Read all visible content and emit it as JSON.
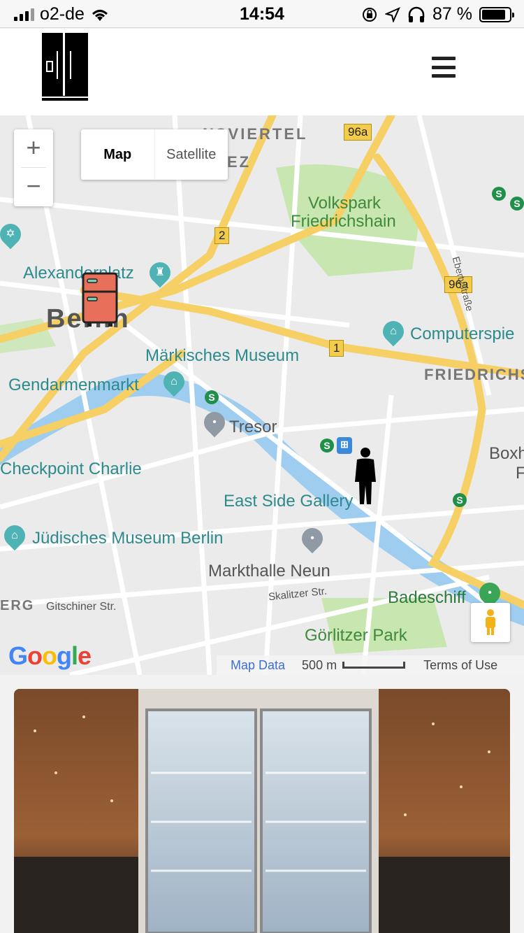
{
  "status_bar": {
    "carrier": "o2-de",
    "time": "14:54",
    "battery_percent": "87 %",
    "battery_level": 0.87
  },
  "header": {
    "logo_icon": "fridge-logo-icon",
    "menu_icon": "hamburger-menu-icon"
  },
  "map": {
    "map_type_options": [
      "Map",
      "Satellite"
    ],
    "selected_map_type": "Map",
    "zoom_in": "+",
    "zoom_out": "−",
    "labels": {
      "volkspark": [
        "Volkspark",
        "Friedrichshain"
      ],
      "alexanderplatz": "Alexanderplatz",
      "berlin": "Berlin",
      "maerkisches_museum": "Märkisches Museum",
      "gendarmenmarkt": "Gendarmenmarkt",
      "tresor": "Tresor",
      "checkpoint_charlie": "Checkpoint Charlie",
      "east_side_gallery": "East Side Gallery",
      "juedisches_museum": "Jüdisches Museum Berlin",
      "markthalle_neun": "Markthalle Neun",
      "badeschiff": "Badeschiff",
      "goerlitzer_park": "Görlitzer Park",
      "computerspiele": "Computerspie",
      "friedrichshain_district": "FRIEDRICHS",
      "viertel": "NSVIERTEL",
      "ez": "EZ",
      "boxh": "Boxh",
      "boxh_f": "F",
      "gitschiner": "Gitschiner Str.",
      "skalitzer": "Skalitzer Str.",
      "erg": "ERG",
      "ebertystrasse": "Ebertystraße"
    },
    "road_shields": [
      "96a",
      "2",
      "96a",
      "1"
    ],
    "google_logo": "Google",
    "map_data": "Map Data",
    "scale": "500 m",
    "terms": "Terms of Use",
    "markers": {
      "fridge": "fridge-marker-icon",
      "user": "person-location-icon"
    }
  },
  "photo": {
    "alt": "community fridge photo"
  },
  "colors": {
    "road_major": "#f6cf65",
    "road_minor": "#ffffff",
    "park": "#c8e6b0",
    "water": "#9fcdf0",
    "poi_teal": "#4fb3b6",
    "fridge_marker": "#e8705b"
  }
}
